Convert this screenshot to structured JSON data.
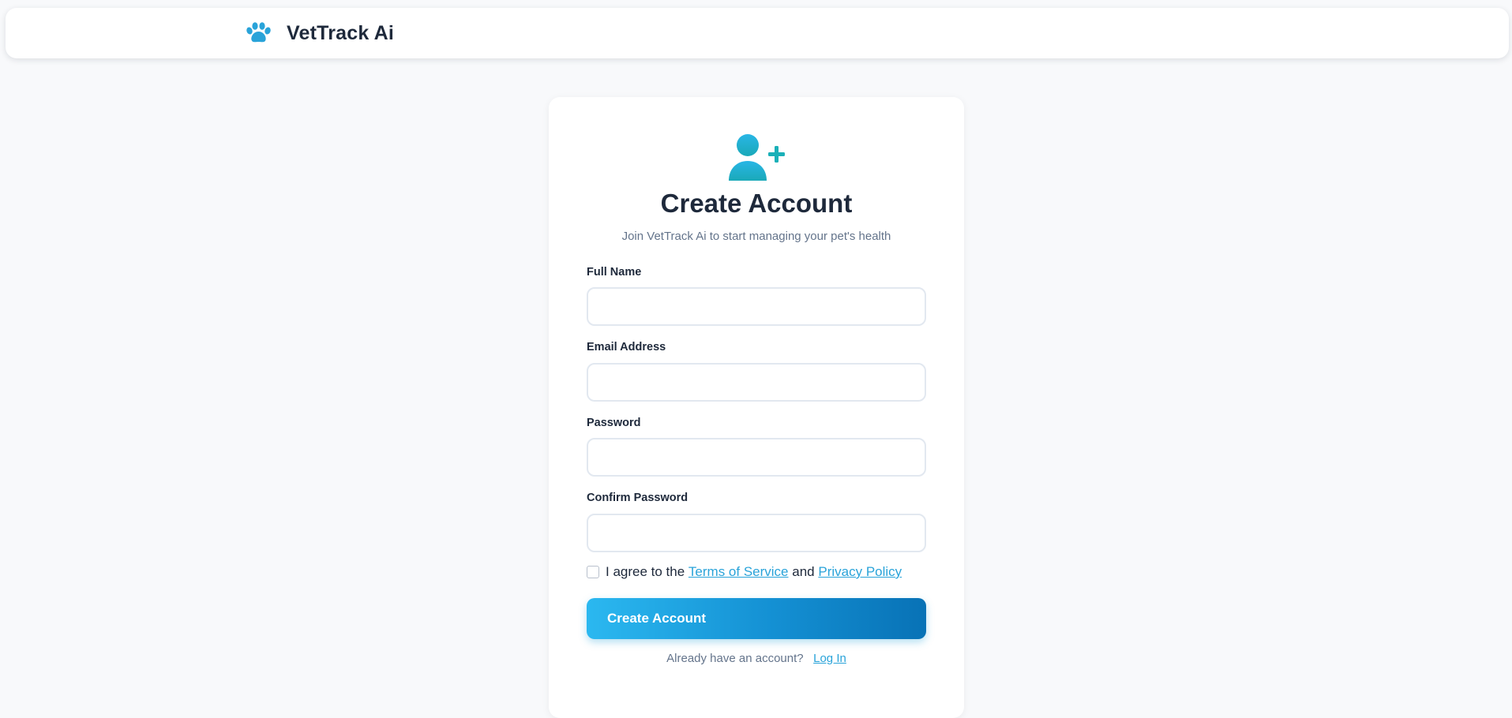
{
  "header": {
    "brand_name": "VetTrack Ai",
    "brand_icon": "paw-icon",
    "brand_color": "#29a3d9"
  },
  "signup": {
    "icon": "user-plus-icon",
    "title": "Create Account",
    "subtitle": "Join VetTrack Ai to start managing your pet's health",
    "fields": [
      {
        "label": "Full Name",
        "value": "",
        "placeholder": ""
      },
      {
        "label": "Email Address",
        "value": "",
        "placeholder": ""
      },
      {
        "label": "Password",
        "value": "",
        "placeholder": ""
      },
      {
        "label": "Confirm Password",
        "value": "",
        "placeholder": ""
      }
    ],
    "terms": {
      "checked": false,
      "prefix": "I agree to the",
      "terms_link": "Terms of Service",
      "and": "and",
      "privacy_link": "Privacy Policy"
    },
    "submit_label": "Create Account",
    "login_prompt": "Already have an account?",
    "login_link": "Log In"
  },
  "colors": {
    "accent": "#29a3d9",
    "button_gradient_start": "#2bb8f0",
    "button_gradient_end": "#0872b6",
    "page_background": "#f8f9fb",
    "heading_text": "#1e293b",
    "muted_text": "#64748b"
  }
}
